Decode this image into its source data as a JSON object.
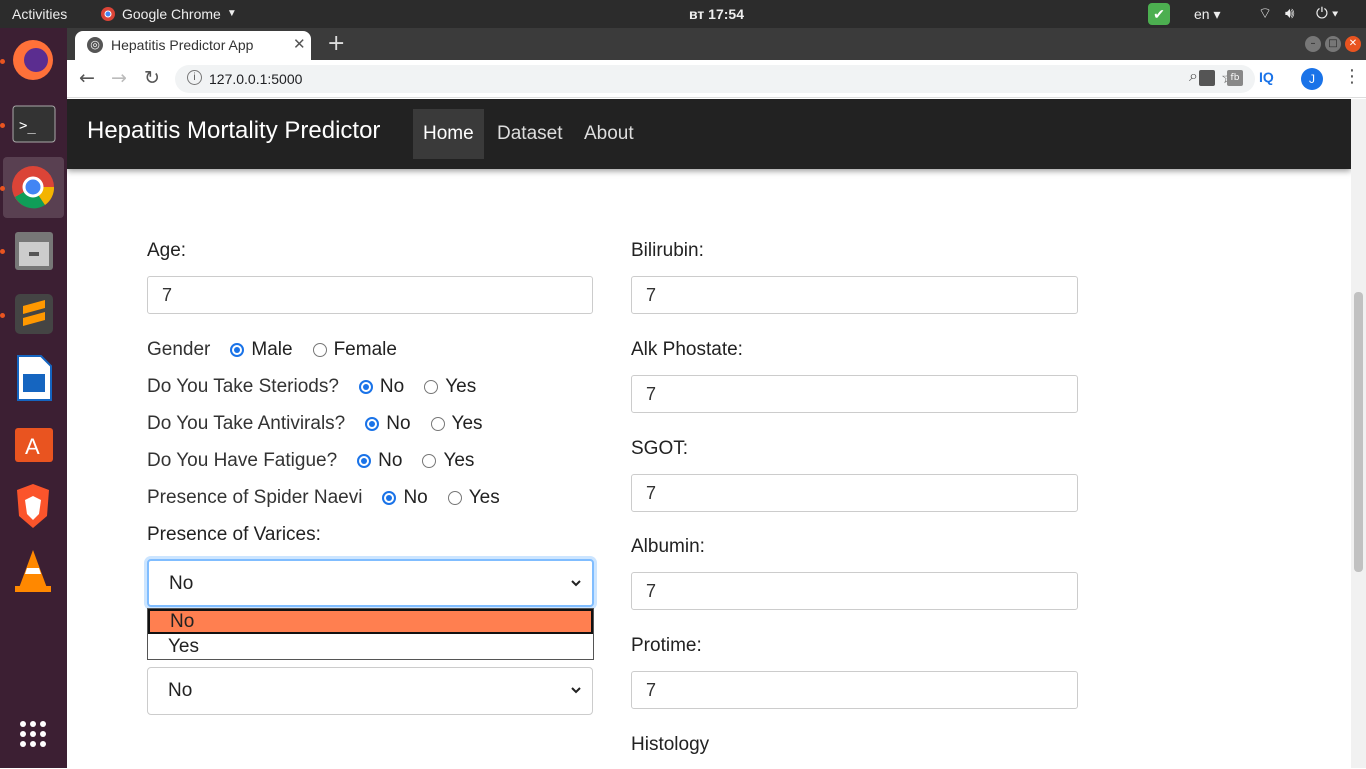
{
  "system_bar": {
    "activities": "Activities",
    "app_name": "Google Chrome",
    "clock": "вт 17:54",
    "language": "en"
  },
  "browser": {
    "tab_title": "Hepatitis Predictor App",
    "url": "127.0.0.1:5000",
    "profile_initial": "J"
  },
  "navbar": {
    "brand": "Hepatitis Mortality Predictor",
    "links": [
      "Home",
      "Dataset",
      "About"
    ]
  },
  "form": {
    "age_label": "Age:",
    "age_value": "7",
    "gender_label": "Gender",
    "gender_male": "Male",
    "gender_female": "Female",
    "steroids_label": "Do You Take Steriods?",
    "antivirals_label": "Do You Take Antivirals?",
    "fatigue_label": "Do You Have Fatigue?",
    "spider_label": "Presence of Spider Naevi",
    "opt_no": "No",
    "opt_yes": "Yes",
    "varices_label": "Presence of Varices:",
    "varices_value": "No",
    "varices_options": [
      "No",
      "Yes"
    ],
    "next_select_value": "No",
    "bilirubin_label": "Bilirubin:",
    "bilirubin_value": "7",
    "alk_label": "Alk Phostate:",
    "alk_value": "7",
    "sgot_label": "SGOT:",
    "sgot_value": "7",
    "albumin_label": "Albumin:",
    "albumin_value": "7",
    "protime_label": "Protime:",
    "protime_value": "7",
    "histology_label": "Histology"
  },
  "colors": {
    "navbar_bg": "#222222",
    "dropdown_highlight": "#ff7f50",
    "radio_checked": "#1a73e8"
  }
}
